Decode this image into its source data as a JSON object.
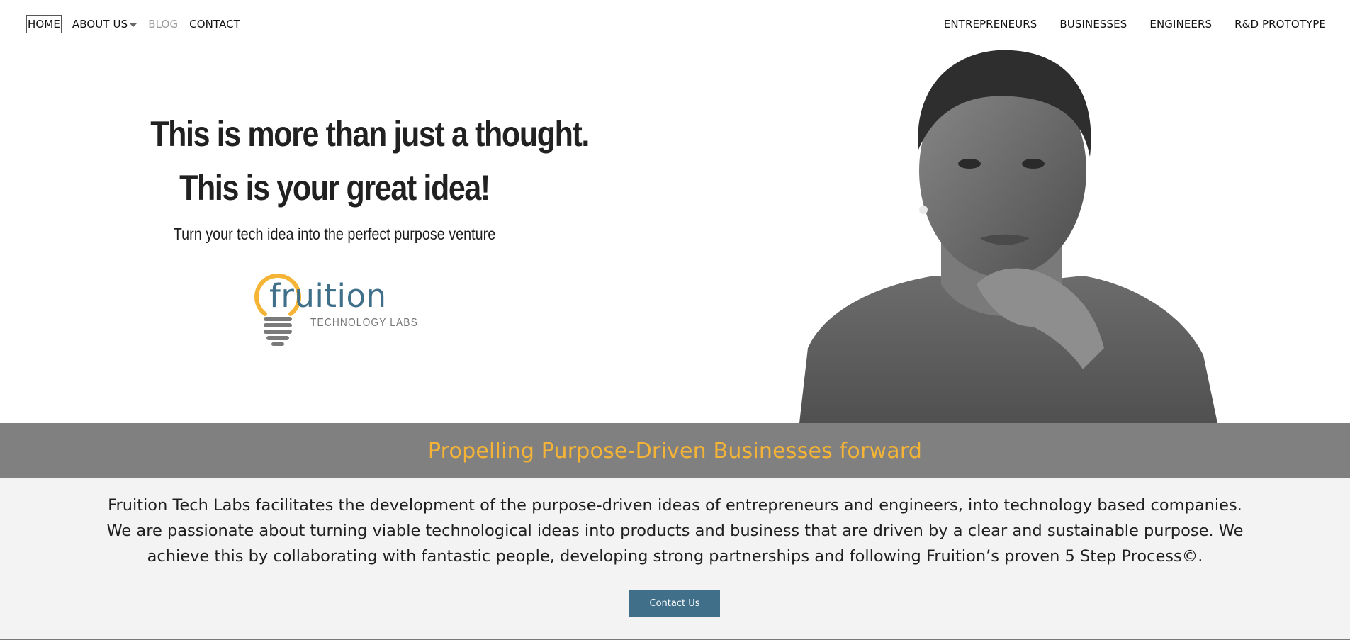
{
  "nav": {
    "left": [
      {
        "label": "HOME",
        "state": "active"
      },
      {
        "label": "ABOUT US",
        "state": "dropdown"
      },
      {
        "label": "BLOG",
        "state": "muted"
      },
      {
        "label": "CONTACT",
        "state": "normal"
      }
    ],
    "right": [
      {
        "label": "ENTREPRENEURS"
      },
      {
        "label": "BUSINESSES"
      },
      {
        "label": "ENGINEERS"
      },
      {
        "label": "R&D PROTOTYPE"
      }
    ]
  },
  "hero": {
    "headline_line1": "This is more than just a thought.",
    "headline_line2": "This is your great idea!",
    "subline": "Turn your tech idea into the perfect purpose venture",
    "logo": {
      "word": "fruition",
      "sub": "TECHNOLOGY LABS",
      "bulb_color": "#f5b435",
      "text_color": "#3f6f89",
      "base_color": "#7a7a7a"
    },
    "portrait_icon": "woman-portrait-image"
  },
  "banner": {
    "title": "Propelling Purpose-Driven Businesses forward",
    "title_color": "#f5b435",
    "background": "#808080"
  },
  "about": {
    "text": "Fruition Tech Labs facilitates the development of the purpose-driven ideas of entrepreneurs and engineers, into technology based companies. We are passionate about turning viable technological ideas into products and business that are driven by a clear and sustainable purpose. We achieve this by collaborating with fantastic people, developing strong partnerships and following Fruition’s proven 5 Step Process©.",
    "button_label": "Contact Us",
    "button_color": "#3f6f89"
  }
}
